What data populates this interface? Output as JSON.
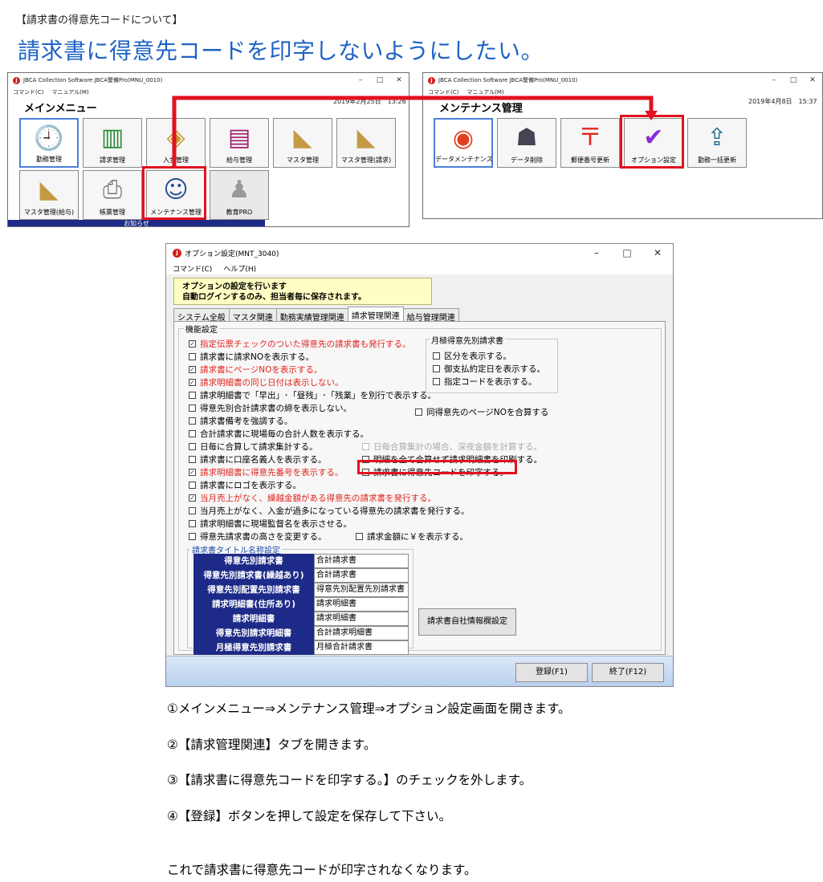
{
  "page": {
    "tag": "【請求書の得意先コードについて】",
    "heading": "請求書に得意先コードを印字しないようにしたい。"
  },
  "main_menu_window": {
    "title": "JBCA Collection Software JBCA警備Pro(MNU_0010)",
    "menu": [
      "コマンド(C)",
      "マニュアル(M)"
    ],
    "heading": "メインメニュー",
    "date": "2019年2月25日　13:26",
    "tiles": [
      {
        "label": "勤務管理",
        "icon": "clock-doc-icon"
      },
      {
        "label": "請求管理",
        "icon": "money-stack-icon"
      },
      {
        "label": "入金管理",
        "icon": "deposit-icon"
      },
      {
        "label": "給与管理",
        "icon": "salary-icon"
      },
      {
        "label": "マスタ管理",
        "icon": "folder-icon"
      },
      {
        "label": "マスタ管理(請求)",
        "icon": "folder-icon"
      },
      {
        "label": "マスタ管理(給与)",
        "icon": "folder-icon"
      },
      {
        "label": "帳票管理",
        "icon": "printer-icon"
      },
      {
        "label": "メンテナンス管理",
        "icon": "maintenance-person-icon"
      },
      {
        "label": "教育PRO",
        "icon": "education-icon"
      }
    ],
    "notice": "お知らせ"
  },
  "maintenance_window": {
    "title": "JBCA Collection Software JBCA警備Pro(MNU_0010)",
    "menu": [
      "コマンド(C)",
      "マニュアル(M)"
    ],
    "heading": "メンテナンス管理",
    "date": "2019年4月8日　15:37",
    "tiles": [
      {
        "label": "データメンテナンス",
        "icon": "data-maintenance-icon"
      },
      {
        "label": "データ削除",
        "icon": "data-delete-icon"
      },
      {
        "label": "郵便番号更新",
        "icon": "postal-icon"
      },
      {
        "label": "オプション設定",
        "icon": "yes-no-icon"
      },
      {
        "label": "勤務一括更新",
        "icon": "batch-update-icon"
      }
    ]
  },
  "option_window": {
    "title": "オプション設定(MNT_3040)",
    "menu": [
      "コマンド(C)",
      "ヘルプ(H)"
    ],
    "info_line1": "オプションの設定を行います",
    "info_line2": "自動ログインするのみ、担当者毎に保存されます。",
    "tabs": [
      "システム全般",
      "マスタ関連",
      "勤務実績管理関連",
      "請求管理関連",
      "給与管理関連"
    ],
    "active_tab": "請求管理関連",
    "group_title": "機能設定",
    "monthly_group_title": "月極得意先別請求書",
    "options": [
      {
        "text": "指定伝票チェックのついた得意先の請求書も発行する。",
        "checked": true,
        "red": true
      },
      {
        "text": "請求書に請求NOを表示する。",
        "checked": false
      },
      {
        "text": "請求書にページNOを表示する。",
        "checked": true,
        "red": true
      },
      {
        "text": "請求明細書の同じ日付は表示しない。",
        "checked": true,
        "red": true
      },
      {
        "text": "請求明細書で「早出」･「昼残」･「残業」を別行で表示する。",
        "checked": false
      },
      {
        "text": "得意先別合計請求書の締を表示しない。",
        "checked": false
      },
      {
        "text": "請求書備考を強調する。",
        "checked": false
      },
      {
        "text": "合計請求書に現場毎の合計人数を表示する。",
        "checked": false
      },
      {
        "text": "日毎に合算して請求集計する。",
        "checked": false
      },
      {
        "text": "請求書に口座名義人を表示する。",
        "checked": false
      },
      {
        "text": "請求明細書に得意先番号を表示する。",
        "checked": true,
        "red": true
      },
      {
        "text": "請求書にロゴを表示する。",
        "checked": false
      },
      {
        "text": "当月売上がなく、繰越金額がある得意先の請求書を発行する。",
        "checked": true,
        "red": true
      },
      {
        "text": "当月売上がなく、入金が過多になっている得意先の請求書を発行する。",
        "checked": false
      },
      {
        "text": "請求明細書に現場監督名を表示させる。",
        "checked": false
      },
      {
        "text": "得意先請求書の高さを変更する。",
        "checked": false
      }
    ],
    "monthly_options": [
      "区分を表示する。",
      "御支払約定日を表示する。",
      "指定コードを表示する。"
    ],
    "right_options": [
      {
        "text": "同得意先のページNOを合算する",
        "checked": false
      },
      {
        "text": "日毎合算集計の場合、深夜金額を計算する。",
        "checked": false,
        "disabled": true
      },
      {
        "text": "明細を全て合算せず請求明細書を印刷する。",
        "checked": false
      },
      {
        "text": "請求書に得意先コードを印字する。",
        "checked": false
      },
      {
        "text": "請求金額に￥を表示する。",
        "checked": false
      }
    ],
    "title_group": "請求書タイトル名称設定",
    "title_rows": [
      {
        "label": "得意先別請求書",
        "value": "合計請求書"
      },
      {
        "label": "得意先別請求書(繰越あり)",
        "value": "合計請求書"
      },
      {
        "label": "得意先別配置先別請求書",
        "value": "得意先別配置先別請求書"
      },
      {
        "label": "請求明細書(住所あり)",
        "value": "請求明細書"
      },
      {
        "label": "請求明細書",
        "value": "請求明細書"
      },
      {
        "label": "得意先別請求明細書",
        "value": "合計請求明細書"
      },
      {
        "label": "月極得意先別請求書",
        "value": "月極合計請求書"
      }
    ],
    "company_info_button": "請求書自社情報欄設定",
    "save_button": "登録(F1)",
    "close_button": "終了(F12)"
  },
  "steps": [
    "①メインメニュー⇒メンテナンス管理⇒オプション設定画面を開きます。",
    "②【請求管理関連】タブを開きます。",
    "③【請求書に得意先コードを印字する。】のチェックを外します。",
    "④【登録】ボタンを押して設定を保存して下さい。"
  ],
  "conclusion": "これで請求書に得意先コードが印字されなくなります。",
  "colors": {
    "heading": "#1e63c4",
    "highlight": "#e2111f",
    "navy": "#1d2a87",
    "red_option": "#e0241d",
    "info_bg": "#ffffc4"
  }
}
